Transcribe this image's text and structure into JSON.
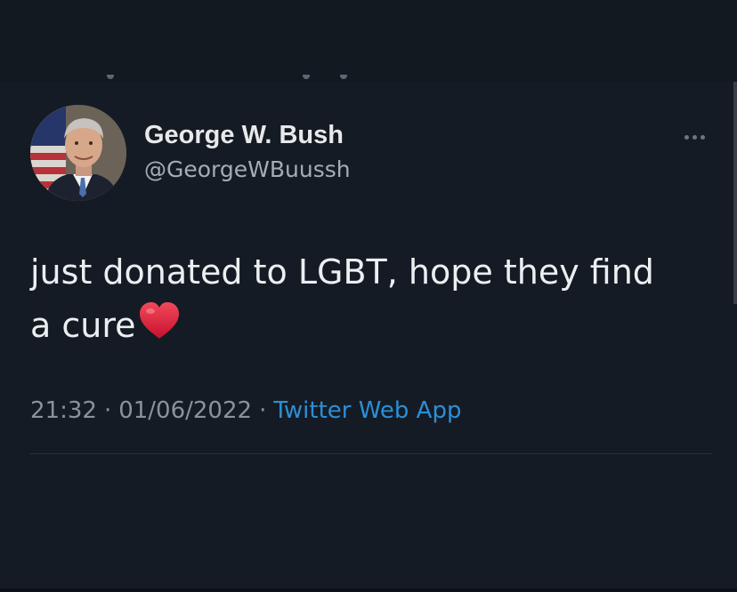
{
  "tweet": {
    "display_name": "George W. Bush",
    "handle": "@GeorgeWBuussh",
    "text_line1": "just donated to LGBT, hope they find",
    "text_line2": "a cure",
    "emoji_icon": "red-heart-icon",
    "time": "21:32",
    "date": "01/06/2022",
    "separator": "·",
    "source": "Twitter Web App"
  },
  "colors": {
    "background": "#151b24",
    "text": "#e7e9ea",
    "muted": "#8a929a",
    "link": "#2a8fd8",
    "heart": "#e0243a"
  }
}
